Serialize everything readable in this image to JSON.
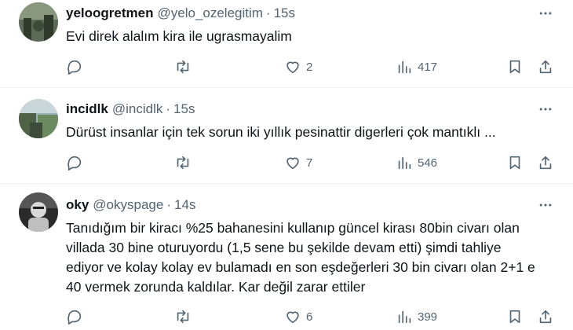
{
  "tweets": [
    {
      "name": "yeloogretmen",
      "handle": "@yelo_ozelegitim",
      "time": "15s",
      "text": [
        "Evi direk alalım kira ile ugrasmayalim"
      ],
      "likes": "2",
      "views": "417",
      "avatar_colors": [
        "#5b6b58",
        "#2f3a2c"
      ]
    },
    {
      "name": "incidlk",
      "handle": "@incidlk",
      "time": "15s",
      "text": [
        "Dürüst insanlar için tek sorun iki yıllık pesinattir digerleri çok mantıklı ..."
      ],
      "likes": "7",
      "views": "546",
      "avatar_colors": [
        "#6c8a5f",
        "#3c4b3a"
      ]
    },
    {
      "name": "oky",
      "handle": "@okyspage",
      "time": "14s",
      "text": [
        "Tanıdığım bir kiracı %25 bahanesini kullanıp güncel kirası 80bin civarı olan",
        "villada 30 bine oturuyordu (1,5 sene bu şekilde devam etti) şimdi tahliye",
        "ediyor ve kolay kolay ev bulamadı en son eşdeğerleri 30 bin civarı olan 2+1 e",
        "40 vermek zorunda kaldılar. Kar değil zarar ettiler"
      ],
      "likes": "6",
      "views": "399",
      "avatar_colors": [
        "#3a3a3a",
        "#d9d9d9"
      ]
    }
  ],
  "separator": "·",
  "icons": {
    "more": "more-dots-icon",
    "reply": "reply-icon",
    "retweet": "retweet-icon",
    "like": "heart-icon",
    "views": "views-chart-icon",
    "bookmark": "bookmark-icon",
    "share": "share-icon"
  },
  "colors": {
    "text_primary": "#0f1419",
    "text_secondary": "#536471",
    "divider": "#eff3f4"
  }
}
